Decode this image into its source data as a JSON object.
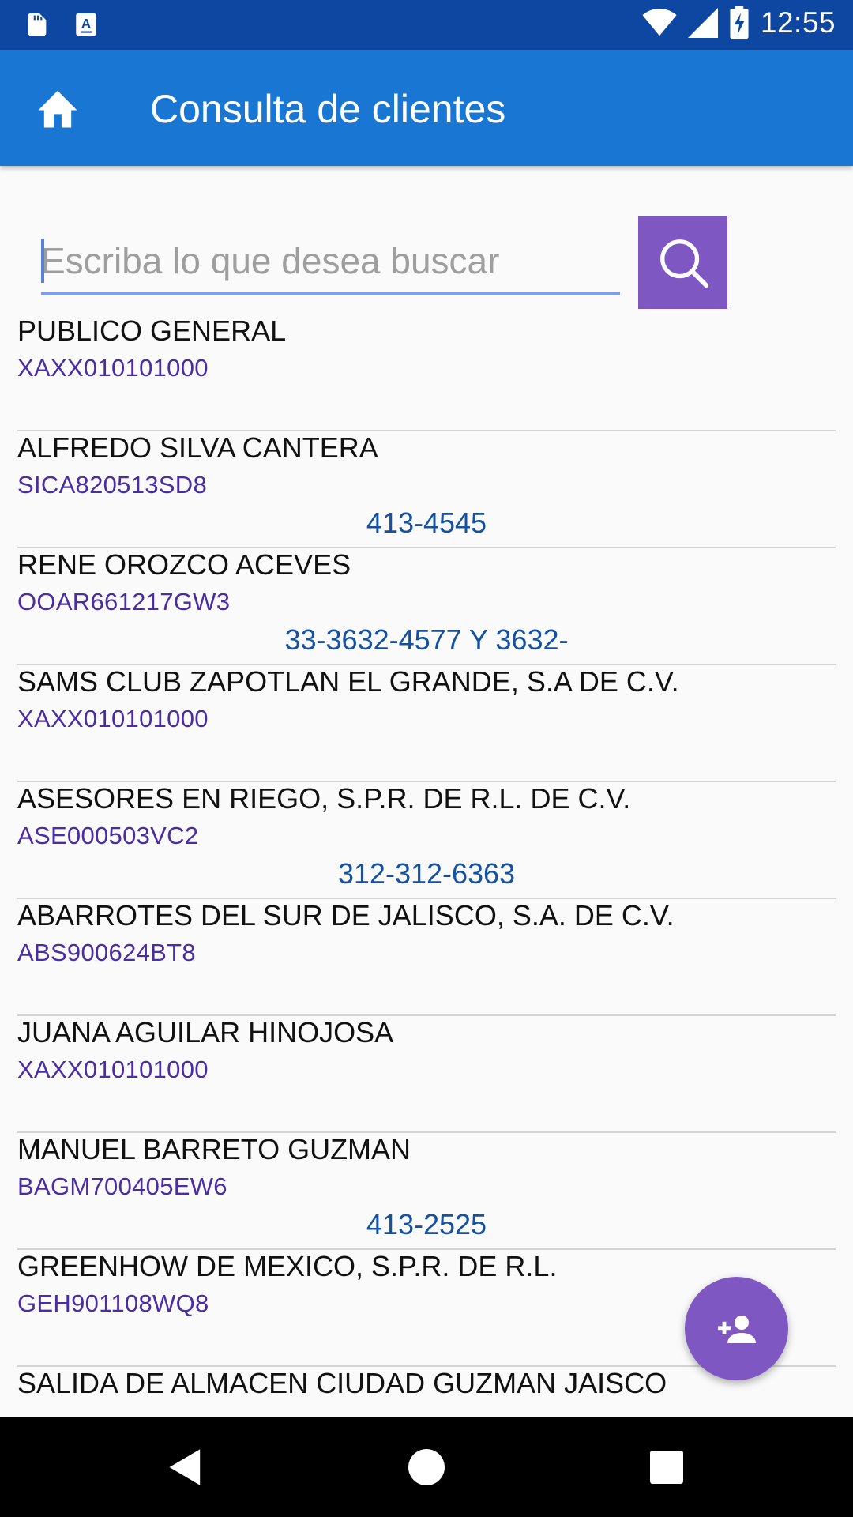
{
  "status_bar": {
    "time": "12:55",
    "icons": [
      "sd-card-icon",
      "a-notification-icon",
      "wifi-icon",
      "signal-icon",
      "battery-charging-icon"
    ]
  },
  "app_bar": {
    "title": "Consulta de clientes",
    "home_icon": "home-icon"
  },
  "search": {
    "placeholder": "Escriba lo que desea buscar",
    "value": "",
    "button_icon": "search-icon"
  },
  "clients": [
    {
      "name": "PUBLICO GENERAL",
      "rfc": "XAXX010101000",
      "phone": ""
    },
    {
      "name": "ALFREDO SILVA CANTERA",
      "rfc": "SICA820513SD8",
      "phone": "413-4545"
    },
    {
      "name": "RENE OROZCO ACEVES",
      "rfc": "OOAR661217GW3",
      "phone": "33-3632-4577 Y 3632-"
    },
    {
      "name": "SAMS CLUB ZAPOTLAN EL GRANDE, S.A DE C.V.",
      "rfc": "XAXX010101000",
      "phone": ""
    },
    {
      "name": "ASESORES EN RIEGO, S.P.R. DE R.L. DE C.V.",
      "rfc": "ASE000503VC2",
      "phone": "312-312-6363"
    },
    {
      "name": "ABARROTES DEL SUR DE JALISCO, S.A. DE C.V.",
      "rfc": "ABS900624BT8",
      "phone": ""
    },
    {
      "name": "JUANA AGUILAR HINOJOSA",
      "rfc": "XAXX010101000",
      "phone": ""
    },
    {
      "name": "MANUEL BARRETO GUZMAN",
      "rfc": "BAGM700405EW6",
      "phone": "413-2525"
    },
    {
      "name": "GREENHOW DE MEXICO, S.P.R. DE R.L.",
      "rfc": "GEH901108WQ8",
      "phone": ""
    },
    {
      "name": "SALIDA DE ALMACEN CIUDAD GUZMAN JAISCO",
      "rfc": "",
      "phone": ""
    }
  ],
  "fab": {
    "icon": "add-person-icon"
  },
  "nav_bar": {
    "icons": [
      "back-icon",
      "home-circle-icon",
      "recents-icon"
    ]
  },
  "colors": {
    "status_bar": "#0d47a1",
    "app_bar": "#1976d2",
    "accent": "#7e57c2",
    "rfc_text": "#4a2ca5",
    "phone_text": "#1251a3"
  }
}
